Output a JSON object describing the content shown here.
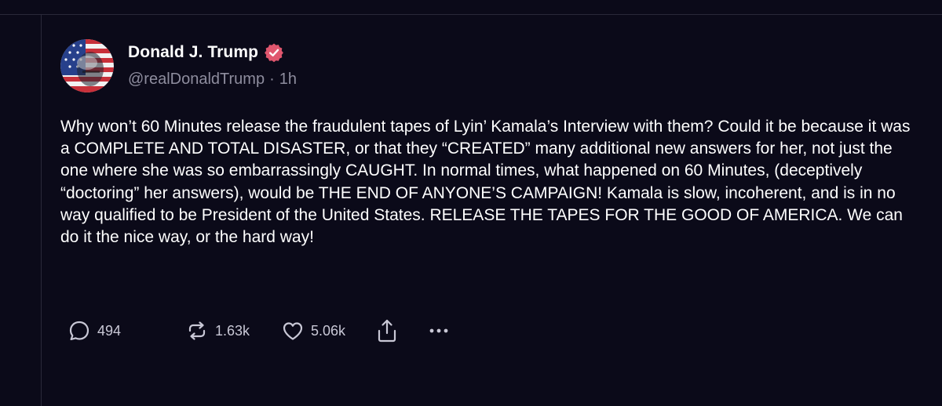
{
  "post": {
    "author": {
      "display_name": "Donald J. Trump",
      "handle": "@realDonaldTrump",
      "time_separator": "·",
      "time": "1h",
      "verified_icon": "verified-badge-icon",
      "verified_color": "#e0566e"
    },
    "text": "Why won’t 60 Minutes release the fraudulent tapes of Lyin’ Kamala’s Interview with them? Could it be because it was a COMPLETE AND TOTAL DISASTER, or that they “CREATED” many additional new answers for her, not just the one where she was so embarrassingly CAUGHT. In normal times, what happened on 60 Minutes, (deceptively “doctoring” her answers), would be THE END OF ANYONE’S CAMPAIGN! Kamala is slow, incoherent, and is in no way qualified to be President of the United States. RELEASE THE TAPES FOR THE GOOD OF AMERICA. We can do it the nice way, or the hard way!",
    "actions": {
      "reply_count": "494",
      "repost_count": "1.63k",
      "like_count": "5.06k"
    }
  },
  "colors": {
    "background": "#0b0a19",
    "text": "#ffffff",
    "muted": "#8e8d9e",
    "border": "#2a2939"
  }
}
